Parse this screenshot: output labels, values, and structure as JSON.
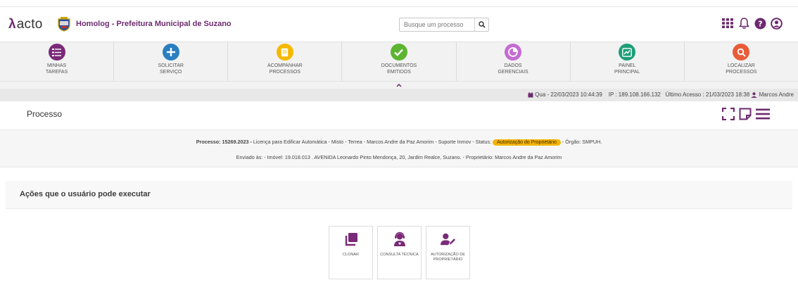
{
  "header": {
    "logo_text": "acto",
    "org_name": "Homolog - Prefeitura Municipal de Suzano",
    "search_placeholder": "Busque um processo",
    "icons": [
      "grid-icon",
      "bell-icon",
      "help-icon",
      "user-icon"
    ]
  },
  "nav": {
    "items": [
      {
        "line1": "MINHAS",
        "line2": "TAREFAS",
        "icon": "tasks-icon",
        "color": "#7a2a78"
      },
      {
        "line1": "SOLICITAR",
        "line2": "SERVIÇO",
        "icon": "plus-icon",
        "color": "#2a7fc0"
      },
      {
        "line1": "ACOMPANHAR",
        "line2": "PROCESSOS",
        "icon": "folder-icon",
        "color": "#f5b800"
      },
      {
        "line1": "DOCUMENTOS",
        "line2": "EMITIDOS",
        "icon": "check-icon",
        "color": "#5cb531"
      },
      {
        "line1": "DADOS",
        "line2": "GERENCIAIS",
        "icon": "pie-icon",
        "color": "#c46bd4"
      },
      {
        "line1": "PAINEL",
        "line2": "PRINCIPAL",
        "icon": "chart-icon",
        "color": "#1e9e7a"
      },
      {
        "line1": "LOCALIZAR",
        "line2": "PROCESSOS",
        "icon": "search-icon",
        "color": "#e85c3a"
      }
    ]
  },
  "status": {
    "date": "Qua - 22/03/2023 10:44:39",
    "ip": "IP : 189.108.166.132",
    "last_access": "Último Acesso : 21/03/2023 18:38",
    "user": "Marcos Andre"
  },
  "page": {
    "title": "Processo"
  },
  "process": {
    "label": "Processo: 15269.2023 -",
    "description": "Licença para Edificar Automática - Misto - Terrea - Marcos Andre da Paz Amorim - Suporte Inmov - Status:",
    "status_badge": "Autorização do Proprietário",
    "orgao": "- Órgão: SMPUH.",
    "details": "Enviado às: - Imóvel: 19.018.013 . AVENIDA Leonardo Pinto Mendonça, 20, Jardim Realce, Suzano. - Proprietário: Marcos Andre da Paz Amorim"
  },
  "actions": {
    "title": "Ações que o usuário pode executar",
    "cards": [
      {
        "label": "CLONAR",
        "icon": "clone-icon"
      },
      {
        "label": "CONSULTA TÉCNICA",
        "icon": "support-agent-icon"
      },
      {
        "label": "AUTORIZAÇÃO DE PROPRIETÁRIO",
        "icon": "user-edit-icon"
      }
    ]
  },
  "colors": {
    "brand": "#6d2a6e",
    "badge": "#f4b400"
  }
}
